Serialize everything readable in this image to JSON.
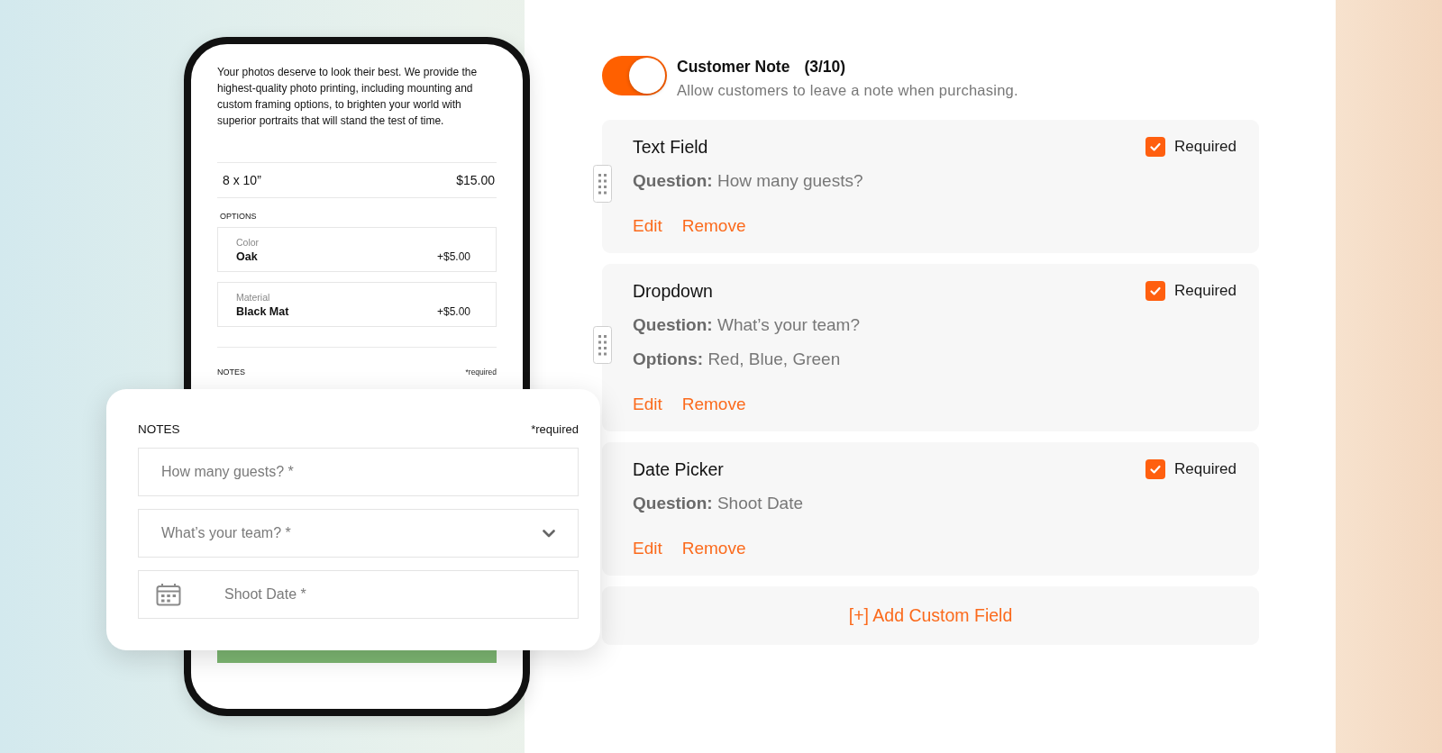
{
  "phone_preview": {
    "description": "Your photos deserve to look their best. We provide the highest-quality photo printing, including mounting and custom framing options, to brighten your world with superior portraits that will stand the test of time.",
    "product": {
      "size": "8 x 10”",
      "price": "$15.00"
    },
    "options_heading": "OPTIONS",
    "options": [
      {
        "label": "Color",
        "value": "Oak",
        "price": "+$5.00"
      },
      {
        "label": "Material",
        "value": "Black Mat",
        "price": "+$5.00"
      }
    ],
    "notes_heading": "NOTES",
    "required_note": "*required"
  },
  "notes_popup": {
    "heading": "NOTES",
    "required_note": "*required",
    "fields": [
      {
        "kind": "text",
        "placeholder": "How many guests? *"
      },
      {
        "kind": "dropdown",
        "placeholder": "What’s your team? *"
      },
      {
        "kind": "date",
        "placeholder": "Shoot Date *"
      }
    ]
  },
  "customer_note": {
    "on": true,
    "title": "Customer Note",
    "count": "(3/10)",
    "description": "Allow customers to leave a note when purchasing."
  },
  "custom_fields": [
    {
      "title": "Text Field",
      "required": true,
      "required_label": "Required",
      "drag_handle": true,
      "details": [
        "**Question:** How many guests?"
      ],
      "actions": [
        "Edit",
        "Remove"
      ]
    },
    {
      "title": "Dropdown",
      "required": true,
      "required_label": "Required",
      "drag_handle": true,
      "details": [
        "**Question:** What’s your team?",
        "**Options:** Red, Blue, Green"
      ],
      "actions": [
        "Edit",
        "Remove"
      ]
    },
    {
      "title": "Date Picker",
      "required": true,
      "required_label": "Required",
      "drag_handle": false,
      "details": [
        "**Question:** Shoot Date"
      ],
      "actions": [
        "Edit",
        "Remove"
      ]
    }
  ],
  "add_button": "[+] Add Custom Field"
}
